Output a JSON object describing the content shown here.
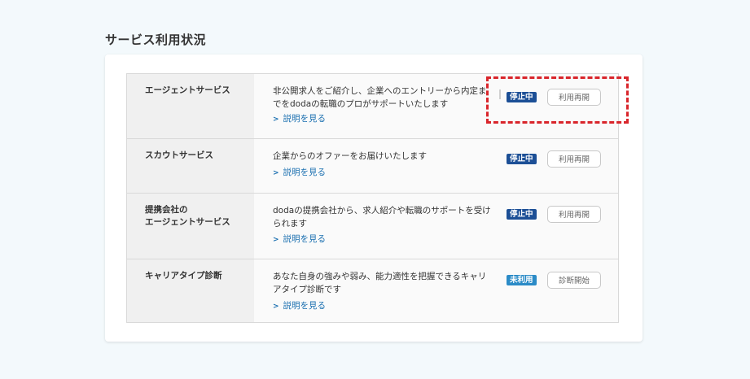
{
  "page": {
    "title": "サービス利用状況"
  },
  "services": [
    {
      "name": "エージェントサービス",
      "description": "非公開求人をご紹介し、企業へのエントリーから内定までをdodaの転職のプロがサポートいたします",
      "link": "説明を見る",
      "status": "停止中",
      "action": "利用再開"
    },
    {
      "name": "スカウトサービス",
      "description": "企業からのオファーをお届けいたします",
      "link": "説明を見る",
      "status": "停止中",
      "action": "利用再開"
    },
    {
      "name": "提携会社の\nエージェントサービス",
      "description": "dodaの提携会社から、求人紹介や転職のサポートを受けられます",
      "link": "説明を見る",
      "status": "停止中",
      "action": "利用再開"
    },
    {
      "name": "キャリアタイプ診断",
      "description": "あなた自身の強みや弱み、能力適性を把握できるキャリアタイプ診断です",
      "link": "説明を見る",
      "status": "未利用",
      "action": "診断開始"
    }
  ],
  "colors": {
    "status_stopped": "#1c4f96",
    "status_unused": "#2b8bc7",
    "link": "#1a6fb0",
    "highlight": "#d9252b"
  }
}
